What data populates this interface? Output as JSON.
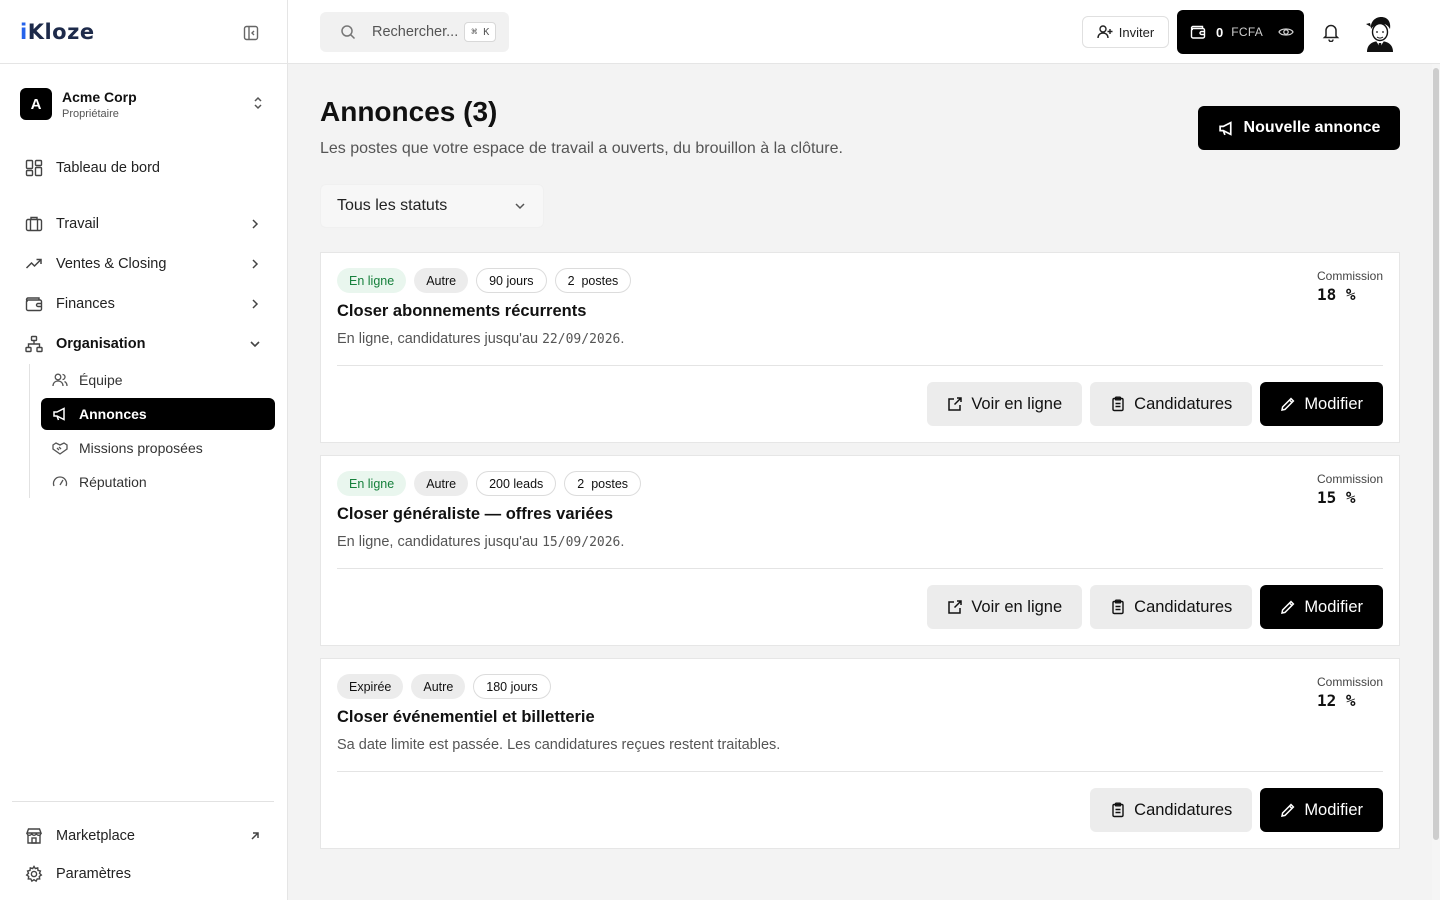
{
  "brand": {
    "prefix": "i",
    "rest": "Kloze"
  },
  "workspace": {
    "initial": "A",
    "name": "Acme Corp",
    "role": "Propriétaire"
  },
  "nav": {
    "dashboard": "Tableau de bord",
    "work": "Travail",
    "sales": "Ventes & Closing",
    "finance": "Finances",
    "organisation": "Organisation",
    "sub": [
      "Équipe",
      "Annonces",
      "Missions proposées",
      "Réputation"
    ],
    "marketplace": "Marketplace",
    "settings": "Paramètres"
  },
  "topbar": {
    "search_placeholder": "Rechercher...",
    "shortcut": "⌘ K",
    "invite_label": "Inviter",
    "wallet_amount": "0",
    "wallet_currency": "FCFA"
  },
  "page": {
    "title": "Annonces (3)",
    "subtitle": "Les postes que votre espace de travail a ouverts, du brouillon à la clôture.",
    "new_button": "Nouvelle annonce",
    "status_filter": "Tous les statuts"
  },
  "listings": [
    {
      "status": "En ligne",
      "category": "Autre",
      "duration": "90 jours",
      "positions": "2  postes",
      "title": "Closer abonnements récurrents",
      "desc_prefix": "En ligne, candidatures jusqu'au ",
      "date": "22/09/2026",
      "desc_suffix": ".",
      "commission_label": "Commission",
      "commission_value": "18 %",
      "btn_view": "Voir en ligne",
      "btn_apps": "Candidatures",
      "btn_edit": "Modifier"
    },
    {
      "status": "En ligne",
      "category": "Autre",
      "duration": "200 leads",
      "positions": "2  postes",
      "title": "Closer généraliste — offres variées",
      "desc_prefix": "En ligne, candidatures jusqu'au ",
      "date": "15/09/2026",
      "desc_suffix": ".",
      "commission_label": "Commission",
      "commission_value": "15 %",
      "btn_view": "Voir en ligne",
      "btn_apps": "Candidatures",
      "btn_edit": "Modifier"
    },
    {
      "status": "Expirée",
      "category": "Autre",
      "duration": "180 jours",
      "title": "Closer événementiel et billetterie",
      "desc_prefix": "Sa date limite est passée. Les candidatures reçues restent traitables.",
      "commission_label": "Commission",
      "commission_value": "12 %",
      "btn_apps": "Candidatures",
      "btn_edit": "Modifier"
    }
  ],
  "colors": {
    "online_bg": "#e9f6ee",
    "online_text": "#16803c",
    "primary": "#000000"
  }
}
